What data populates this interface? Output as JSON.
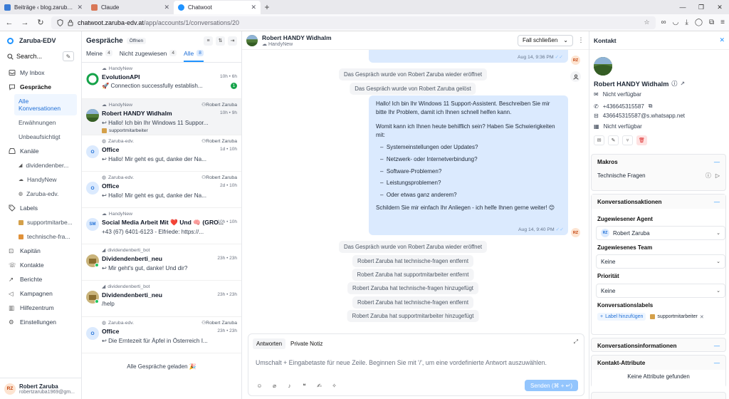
{
  "browser": {
    "tabs": [
      {
        "title": "Beiträge ‹ blog.zaruba-edv.at —",
        "fav": "#3a7bd5"
      },
      {
        "title": "Claude",
        "fav": "#d97757"
      },
      {
        "title": "Chatwoot",
        "fav": "#1f93ff"
      }
    ],
    "url_domain": "chatwoot.zaruba-edv.at",
    "url_path": "/app/accounts/1/conversations/20"
  },
  "sidebar": {
    "workspace": "Zaruba-EDV",
    "search": "Search...",
    "items": {
      "inbox": "My Inbox",
      "conversations": "Gespräche",
      "all": "Alle Konversationen",
      "mentions": "Erwähnungen",
      "unattended": "Unbeaufsichtigt",
      "channels": "Kanäle",
      "ch1": "dividendenber...",
      "ch2": "HandyNew",
      "ch3": "Zaruba-edv.",
      "labels": "Labels",
      "lbl1": "supportmitarbe...",
      "lbl2": "technische-fra...",
      "captain": "Kapitän",
      "contacts": "Kontakte",
      "reports": "Berichte",
      "campaigns": "Kampagnen",
      "helpcenter": "Hilfezentrum",
      "settings": "Einstellungen"
    },
    "user": {
      "initials": "RZ",
      "name": "Robert Zaruba",
      "email": "robertzaruba1969@gm..."
    }
  },
  "convlist": {
    "title": "Gespräche",
    "status": "Öffnen",
    "tabs": [
      {
        "label": "Meine",
        "count": "4"
      },
      {
        "label": "Nicht zugewiesen",
        "count": "4"
      },
      {
        "label": "Alle",
        "count": "8"
      }
    ],
    "items": [
      {
        "inbox": "HandyNew",
        "agent": "",
        "name": "EvolutionAPI",
        "time": "10h • 6h",
        "msg": "🚀 Connection successfully establish...",
        "unread": "1",
        "initial": ""
      },
      {
        "inbox": "HandyNew",
        "agent": "Robert Zaruba",
        "name": "Robert HANDY Widhalm",
        "time": "10h • 9h",
        "msg": "↩ Hallo! Ich bin Ihr Windows 11 Suppor...",
        "label": "supportmitarbeiter",
        "initial": ""
      },
      {
        "inbox": "Zaruba-edv.",
        "agent": "Robert Zaruba",
        "name": "Office",
        "time": "1d • 10h",
        "msg": "↩ Hallo! Mir geht es gut, danke der Na...",
        "initial": "O"
      },
      {
        "inbox": "Zaruba-edv.",
        "agent": "Robert Zaruba",
        "name": "Office",
        "time": "2d • 10h",
        "msg": "↩ Hallo! Mir geht es gut, danke der Na...",
        "initial": "O"
      },
      {
        "inbox": "HandyNew",
        "agent": "",
        "name": "Social Media Arbeit Mit ❤️ Und 🧠 (GRO...",
        "time": "10h • 10h",
        "msg": "+43 (67) 6401-6123 - Elfriede: https://...",
        "initial": "SM"
      },
      {
        "inbox": "dividendenberti_bot",
        "agent": "",
        "name": "Dividendenberti_neu",
        "time": "23h • 23h",
        "msg": "↩ Mir geht's gut, danke! Und dir?",
        "initial": ""
      },
      {
        "inbox": "dividendenberti_bot",
        "agent": "",
        "name": "Dividendenberti_neu",
        "time": "23h • 23h",
        "msg": "/help",
        "initial": ""
      },
      {
        "inbox": "Zaruba-edv.",
        "agent": "Robert Zaruba",
        "name": "Office",
        "time": "23h • 23h",
        "msg": "↩ Die Erntezeit für Äpfel in Österreich I...",
        "initial": "O"
      }
    ],
    "all_loaded": "Alle Gespräche geladen 🎉"
  },
  "chat": {
    "contact_name": "Robert HANDY Widhalm",
    "inbox": "HandyNew",
    "resolve": "Fall schließen",
    "time1": "Aug 14, 9:36 PM",
    "act1": "Das Gespräch wurde von Robert Zaruba wieder eröffnet",
    "act2": "Das Gespräch wurde von Robert Zaruba gelöst",
    "bubble_p1": "Hallo! Ich bin Ihr Windows 11 Support-Assistent. Beschreiben Sie mir bitte Ihr Problem, damit ich Ihnen schnell helfen kann.",
    "bubble_p2": "Womit kann ich Ihnen heute behilflich sein? Haben Sie Schwierigkeiten mit:",
    "bullets": [
      "Systemeinstellungen oder Updates?",
      "Netzwerk- oder Internetverbindung?",
      "Software-Problemen?",
      "Leistungsproblemen?",
      "Oder etwas ganz anderem?"
    ],
    "bubble_p3": "Schildern Sie mir einfach Ihr Anliegen - ich helfe Ihnen gerne weiter! 😊",
    "time2": "Aug 14, 9:40 PM",
    "acts": [
      "Das Gespräch wurde von Robert Zaruba wieder eröffnet",
      "Robert Zaruba hat technische-fragen entfernt",
      "Robert Zaruba hat supportmitarbeiter entfernt",
      "Robert Zaruba hat technische-fragen hinzugefügt",
      "Robert Zaruba hat technische-fragen entfernt",
      "Robert Zaruba hat supportmitarbeiter hinzugefügt"
    ],
    "reply_tab": "Antworten",
    "note_tab": "Private Notiz",
    "placeholder": "Umschalt + Eingabetaste für neue Zeile. Beginnen Sie mit '/', um eine vordefinierte Antwort auszuwählen.",
    "send": "Senden (⌘ + ↵)",
    "avatar_initials": "RZ"
  },
  "contact": {
    "title": "Kontakt",
    "name": "Robert HANDY Widhalm",
    "email": "Nicht verfügbar",
    "phone": "+436645315587",
    "whatsapp": "436645315587@s.whatsapp.net",
    "company": "Nicht verfügbar",
    "macros_title": "Makros",
    "macro1": "Technische Fragen",
    "actions_title": "Konversationsaktionen",
    "agent_label": "Zugewiesener Agent",
    "agent_value": "Robert Zaruba",
    "agent_initials": "RZ",
    "team_label": "Zugewiesenes Team",
    "team_value": "Keine",
    "prio_label": "Priorität",
    "prio_value": "Keine",
    "labels_label": "Konversationslabels",
    "add_label": "Label hinzufügen",
    "label1": "supportmitarbeiter",
    "info_title": "Konversationsinformationen",
    "attrs_title": "Kontakt-Attribute",
    "no_attrs": "Keine Attribute gefunden"
  },
  "colors": {
    "accent": "#1f93ff",
    "label_orange": "#d4a04a",
    "bubble": "#dbeafe"
  }
}
